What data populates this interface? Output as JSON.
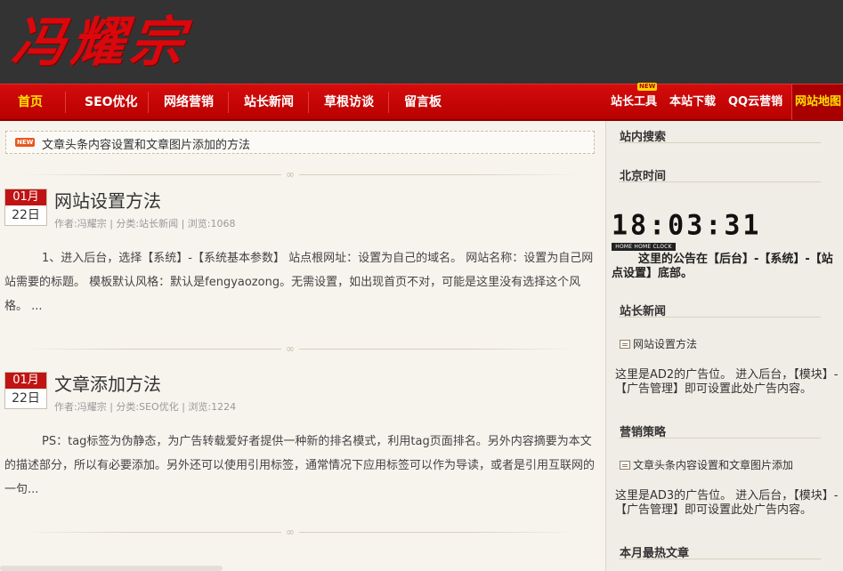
{
  "header": {
    "logo_text": "冯耀宗"
  },
  "nav": {
    "items": [
      "首页",
      "SEO优化",
      "网络营销",
      "站长新闻",
      "草根访谈",
      "留言板"
    ],
    "right_items": [
      "站长工具",
      "本站下载",
      "QQ云营销",
      "网站地图"
    ],
    "new_tag": "NEW"
  },
  "notice": {
    "badge": "NEW",
    "text": "文章头条内容设置和文章图片添加的方法"
  },
  "posts": [
    {
      "month": "01月",
      "day": "22日",
      "title": "网站设置方法",
      "meta": "作者:冯耀宗 | 分类:站长新闻 | 浏览:1068",
      "excerpt": "1、进入后台，选择【系统】-【系统基本参数】 站点根网址：设置为自己的域名。 网站名称：设置为自己网站需要的标题。  模板默认风格：默认是fengyaozong。无需设置，如出现首页不对，可能是这里没有选择这个风格。 ..."
    },
    {
      "month": "01月",
      "day": "22日",
      "title": "文章添加方法",
      "meta": "作者:冯耀宗 | 分类:SEO优化 | 浏览:1224",
      "excerpt": "PS：tag标签为伪静态，为广告转载爱好者提供一种新的排名模式，利用tag页面排名。另外内容摘要为本文的描述部分，所以有必要添加。另外还可以使用引用标签，通常情况下应用标签可以作为导读，或者是引用互联网的一句..."
    }
  ],
  "sidebar": {
    "search_title": "站内搜索",
    "time_title": "北京时间",
    "clock_time": "18:03:31",
    "clock_label": "HOME HOME CLOCK",
    "notice": "这里的公告在【后台】-【系统】-【站点设置】底部。",
    "news_title": "站长新闻",
    "news_link": "网站设置方法",
    "ad2": "这里是AD2的广告位。 进入后台，【模块】-【广告管理】即可设置此处广告内容。",
    "strategy_title": "营销策略",
    "strategy_link": "文章头条内容设置和文章图片添加",
    "ad3": "这里是AD3的广告位。 进入后台，【模块】-【广告管理】即可设置此处广告内容。",
    "hot_title": "本月最热文章"
  },
  "colors": {
    "nav_red": "#c40606",
    "active_yellow": "#ffe000",
    "header_dark": "#333333",
    "date_red": "#c01313"
  }
}
